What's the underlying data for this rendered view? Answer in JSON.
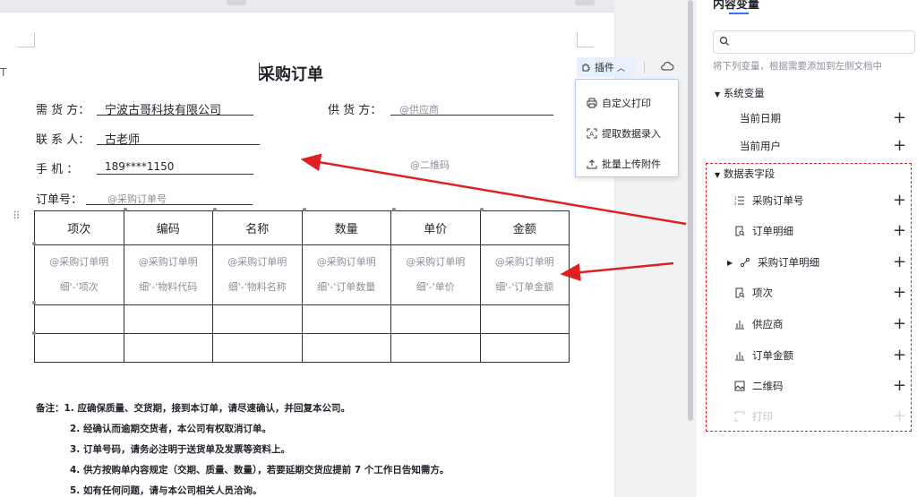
{
  "doc": {
    "title": "采购订单",
    "left_marker": "T",
    "buyer_label": "需 货 方：",
    "buyer_value": "宁波古哥科技有限公司",
    "supplier_label": "供 货 方：",
    "supplier_ph": "@供应商",
    "contact_label": "联 系 人：",
    "contact_value": "古老师",
    "phone_label": "手      机 ：",
    "phone_value": "189****1150",
    "qr_ph": "@二维码",
    "order_label": "订单号：",
    "order_ph": "@采购订单号",
    "table": {
      "headers": [
        "项次",
        "编码",
        "名称",
        "数量",
        "单价",
        "金额"
      ],
      "cells": [
        [
          "@采购订单明",
          "细'-'项次"
        ],
        [
          "@采购订单明",
          "细'-'物料代码"
        ],
        [
          "@采购订单明",
          "细'-'物料名称"
        ],
        [
          "@采购订单明",
          "细'-'订单数量"
        ],
        [
          "@采购订单明",
          "细'-'单价"
        ],
        [
          "@采购订单明",
          "细'-'订单金额"
        ]
      ]
    },
    "notes": [
      "备注：1. 应确保质量、交货期，接到本订单，请尽速确认，并回复本公司。",
      "2. 经确认而逾期交货者，本公司有权取消订单。",
      "3. 订单号码，请务必注明于送货单及发票等资料上。",
      "4. 供方按购单内容规定（交期、质量、数量），若要延期交货应提前 7 个工作日告知需方。",
      "5. 如有任何问题，请与本公司相关人员洽询。"
    ]
  },
  "plugin": {
    "button_label": "插件",
    "items": [
      "自定义打印",
      "提取数据录入",
      "批量上传附件"
    ],
    "icons": [
      "printer-icon",
      "scan-text-icon",
      "upload-icon"
    ]
  },
  "panel": {
    "title": "内容变量",
    "search_placeholder": "",
    "hint": "将下列变量，根据需要添加到左侧文档中",
    "system_section": "系统变量",
    "system_items": [
      "当前日期",
      "当前用户"
    ],
    "data_section": "数据表字段",
    "data_items": [
      {
        "label": "采购订单号",
        "icon": "list-icon"
      },
      {
        "label": "订单明细",
        "icon": "doc-search-icon"
      },
      {
        "label": "采购订单明细",
        "icon": "link-icon"
      },
      {
        "label": "项次",
        "icon": "doc-search-icon"
      },
      {
        "label": "供应商",
        "icon": "bar-chart-icon"
      },
      {
        "label": "订单金额",
        "icon": "bar-chart-icon"
      },
      {
        "label": "二维码",
        "icon": "image-icon"
      },
      {
        "label": "打印",
        "icon": "print-frame-icon"
      }
    ]
  },
  "colors": {
    "accent": "#3370ff",
    "annotation_red": "#e02020",
    "placeholder_gray": "#8a8f99"
  }
}
